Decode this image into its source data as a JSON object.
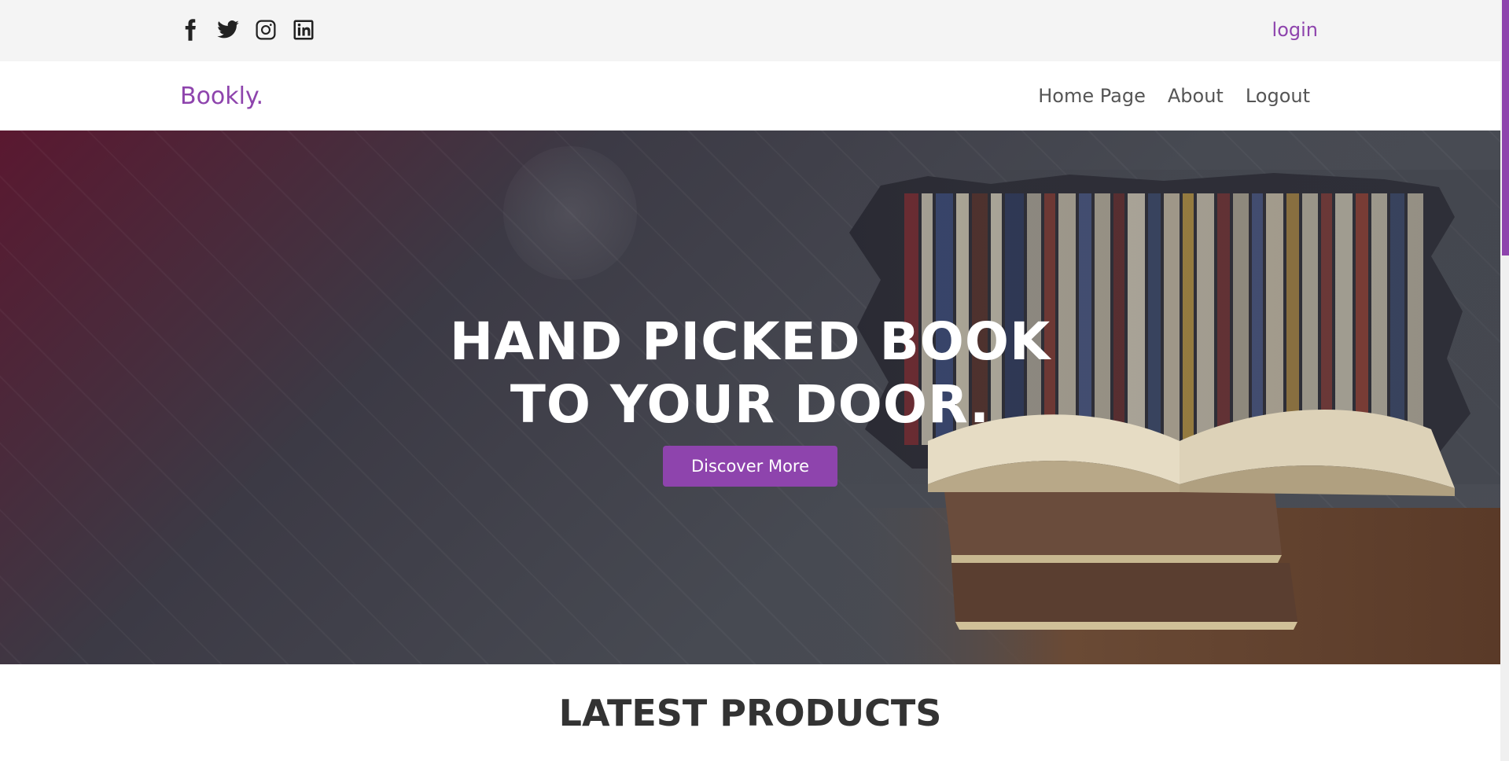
{
  "topbar": {
    "social_icons": [
      "facebook-icon",
      "twitter-icon",
      "instagram-icon",
      "linkedin-icon"
    ],
    "login_label": "login"
  },
  "navbar": {
    "logo": "Bookly.",
    "links": [
      "Home Page",
      "About",
      "Logout"
    ]
  },
  "hero": {
    "title_line1": "HAND PICKED BOOK",
    "title_line2": "TO YOUR DOOR.",
    "cta_label": "Discover More"
  },
  "section": {
    "title": "LATEST PRODUCTS"
  },
  "colors": {
    "accent": "#8e44ad",
    "topbar_bg": "#f4f4f4",
    "text_dark": "#333333"
  }
}
